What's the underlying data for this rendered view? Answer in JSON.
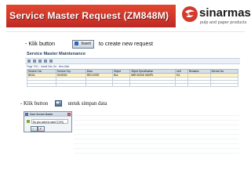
{
  "slide": {
    "title": "Service Master Request (ZM848M)"
  },
  "brand": {
    "logo_name": "sinarmas",
    "logo_tagline": "pulp and paper products",
    "accent_color": "#d33a2c"
  },
  "step1": {
    "prefix": "- Klik button",
    "insert_button_label": "Insert",
    "suffix": "to create new request"
  },
  "sap_window": {
    "title": "Service Master Maintenance",
    "view_text": "Page 7011 : Install Gas Jkt - New After",
    "table": {
      "headers": [
        "Service Cat.",
        "Service Grp.",
        "Desc.",
        "Object",
        "Object Specification",
        "Unit",
        "Remarks",
        "Service No."
      ],
      "rows": [
        [
          "BKSA",
          "5100000",
          "RECOVER",
          "Bus",
          "NBR 5000D 5000PL",
          "EA",
          "",
          ""
        ]
      ]
    }
  },
  "step2": {
    "prefix": "- Klik button",
    "suffix": "untuk simpan data",
    "save_icon": "save-icon"
  },
  "dialog": {
    "title": "Save Service Master",
    "question": "Do you want to save? [Y/N]",
    "ok_icon": "check-icon",
    "cancel_icon": "cancel-icon"
  }
}
